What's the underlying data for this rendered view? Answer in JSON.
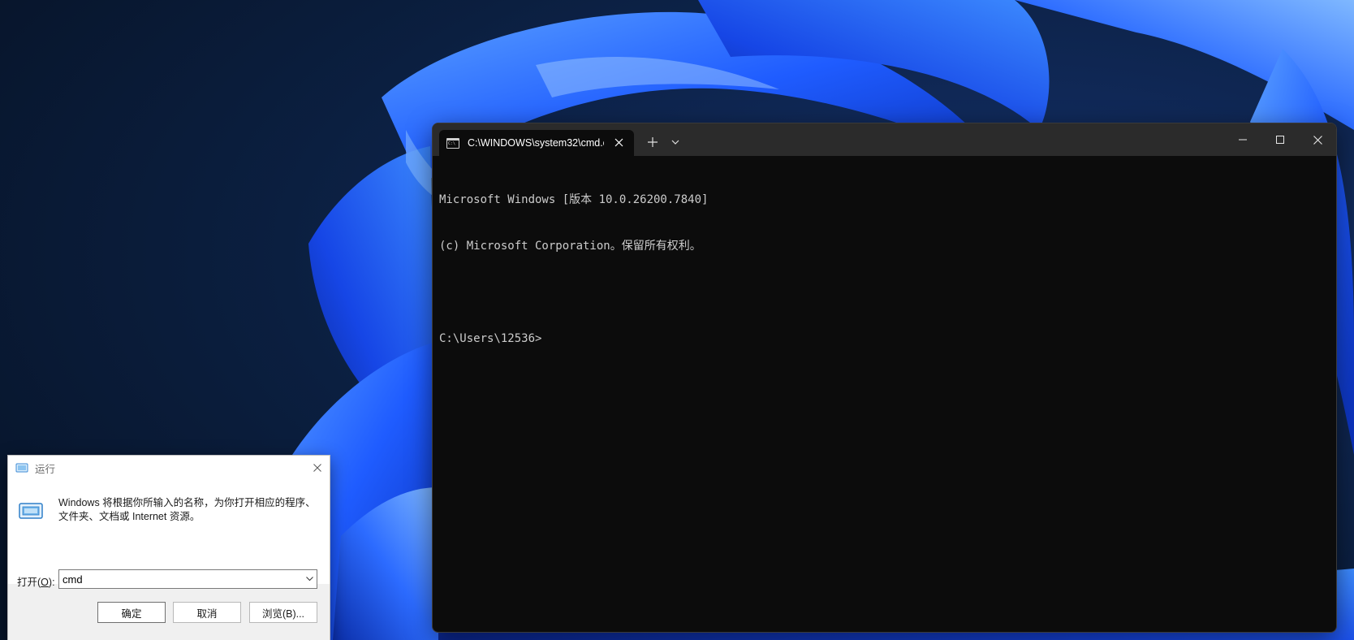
{
  "terminal": {
    "tab_title": "C:\\WINDOWS\\system32\\cmd.e",
    "new_tab_symbol": "+",
    "icons": {
      "tab": "cmd-icon",
      "close": "close-icon",
      "new_tab": "plus-icon",
      "dropdown": "chevron-down-icon",
      "minimize": "minimize-icon",
      "maximize": "maximize-icon",
      "window_close": "close-icon"
    },
    "lines": [
      "Microsoft Windows [版本 10.0.26200.7840]",
      "(c) Microsoft Corporation。保留所有权利。",
      "",
      "C:\\Users\\12536>"
    ],
    "colors": {
      "background": "#0c0c0c",
      "titlebar": "#2b2b2b",
      "text": "#cccccc"
    }
  },
  "run_dialog": {
    "title": "运行",
    "description_line1": "Windows 将根据你所输入的名称，为你打开相应的程序、",
    "description_line2": "文件夹、文档或 Internet 资源。",
    "open_label_prefix": "打开(",
    "open_label_key": "O",
    "open_label_suffix": "):",
    "input_value": "cmd",
    "buttons": {
      "ok": "确定",
      "cancel": "取消",
      "browse": "浏览(B)..."
    },
    "icons": {
      "title": "run-icon",
      "big": "run-icon",
      "close": "close-icon",
      "combo_arrow": "chevron-down-icon"
    }
  },
  "desktop": {
    "wallpaper": "windows-11-bloom",
    "colors": {
      "background": "#0a1a33",
      "bloom": "#1f5cff"
    }
  }
}
